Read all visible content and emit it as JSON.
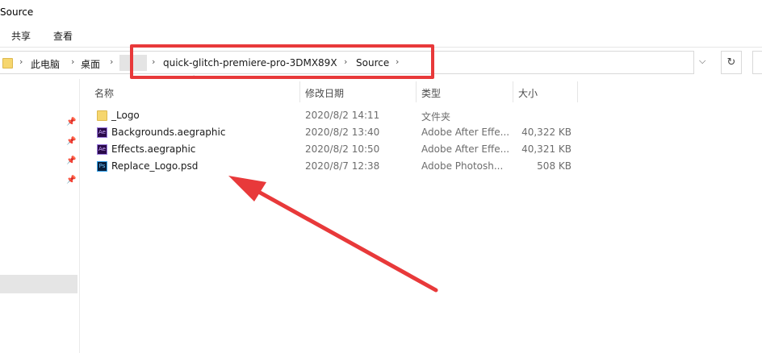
{
  "window": {
    "title": "Source"
  },
  "ribbon": {
    "tabs": [
      {
        "label": "共享"
      },
      {
        "label": "查看"
      }
    ]
  },
  "address": {
    "crumbs": [
      "此电脑",
      "桌面",
      "quick-glitch-premiere-pro-3DMX89X",
      "Source"
    ]
  },
  "columns": {
    "name": "名称",
    "date": "修改日期",
    "type": "类型",
    "size": "大小"
  },
  "files": [
    {
      "name": "_Logo",
      "date": "2020/8/2 14:11",
      "type": "文件夹",
      "size": "",
      "icon": "folder-icon"
    },
    {
      "name": "Backgrounds.aegraphic",
      "date": "2020/8/2 13:40",
      "type": "Adobe After Effe...",
      "size": "40,322 KB",
      "icon": "after-effects-icon"
    },
    {
      "name": "Effects.aegraphic",
      "date": "2020/8/2 10:50",
      "type": "Adobe After Effe...",
      "size": "40,321 KB",
      "icon": "after-effects-icon"
    },
    {
      "name": "Replace_Logo.psd",
      "date": "2020/8/7 12:38",
      "type": "Adobe Photosh...",
      "size": "508 KB",
      "icon": "photoshop-icon"
    }
  ],
  "annotation": {
    "color": "#e8393a"
  }
}
